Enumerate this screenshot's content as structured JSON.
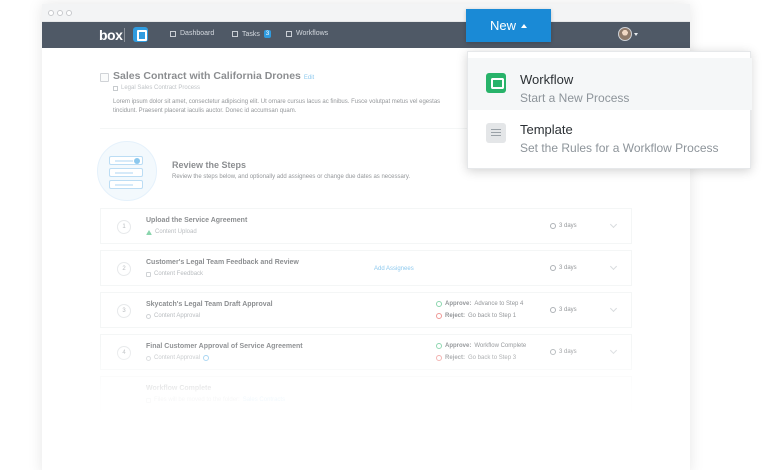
{
  "navbar": {
    "logo": "box",
    "items": [
      {
        "label": "Dashboard"
      },
      {
        "label": "Tasks",
        "badge": "3"
      },
      {
        "label": "Workflows"
      }
    ]
  },
  "header": {
    "title": "Sales Contract with California Drones",
    "edit_label": "Edit",
    "subtitle": "Legal Sales Contract Process",
    "description": "Lorem ipsum dolor sit amet, consectetur adipiscing elit. Ut ornare cursus lacus ac finibus. Fusce volutpat metus vel egestas tincidunt. Praesent placerat iaculis auctor. Donec id accumsan quam."
  },
  "review": {
    "title": "Review the Steps",
    "description": "Review the steps below, and optionally add assignees or change due dates as necessary."
  },
  "steps": [
    {
      "num": "1",
      "title": "Upload the Service Agreement",
      "sub": "Content Upload",
      "due": "3 days"
    },
    {
      "num": "2",
      "title": "Customer's Legal Team Feedback and Review",
      "sub": "Content Feedback",
      "link": "Add Assignees",
      "due": "3 days"
    },
    {
      "num": "3",
      "title": "Skycatch's Legal Team Draft Approval",
      "sub": "Content Approval",
      "approve_label": "Approve:",
      "approve_text": "Advance to Step 4",
      "reject_label": "Reject:",
      "reject_text": "Go back to Step 1",
      "due": "3 days"
    },
    {
      "num": "4",
      "title": "Final Customer Approval of Service Agreement",
      "sub": "Content Approval",
      "approve_label": "Approve:",
      "approve_text": "Workflow Complete",
      "reject_label": "Reject:",
      "reject_text": "Go back to Step 3",
      "due": "3 days"
    },
    {
      "title": "Workflow Complete",
      "sub": "Files will be moved to the folder:",
      "sub_link": "Sales Contracts"
    }
  ],
  "popup": {
    "button_label": "New",
    "items": [
      {
        "title": "Workflow",
        "subtitle": "Start a New Process"
      },
      {
        "title": "Template",
        "subtitle": "Set the Rules for a Workflow Process"
      }
    ]
  },
  "colors": {
    "accent": "#1a8ad6",
    "navbar": "#4f5966",
    "workflow_icon": "#28b36a"
  }
}
